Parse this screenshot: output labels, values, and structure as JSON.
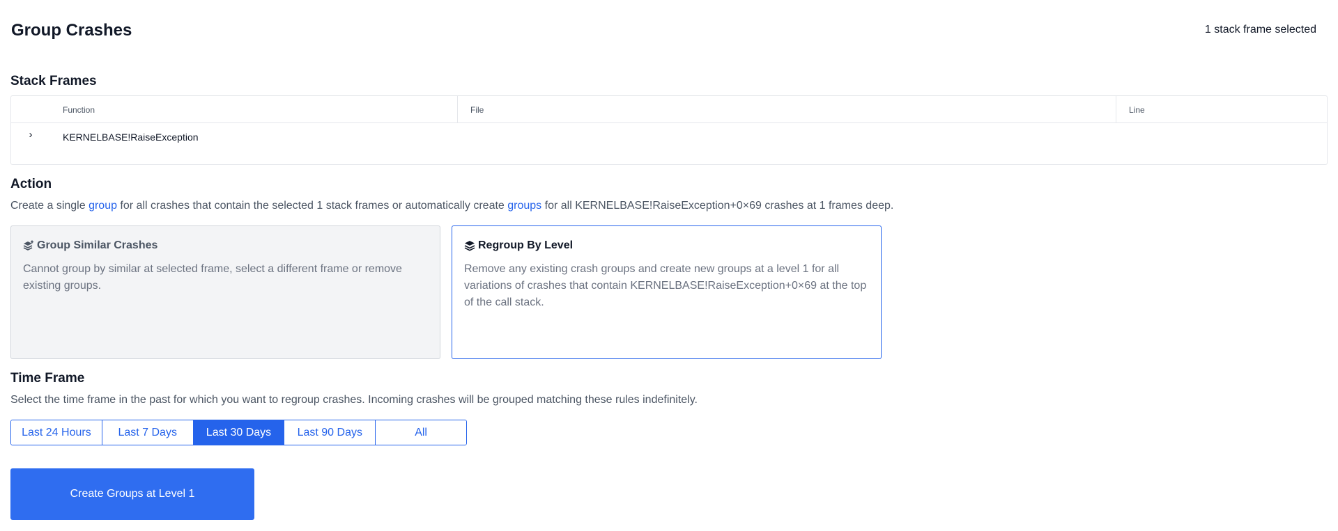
{
  "header": {
    "title": "Group Crashes",
    "selection_status": "1 stack frame selected"
  },
  "stack_frames": {
    "title": "Stack Frames",
    "columns": [
      "Function",
      "File",
      "Line"
    ],
    "rows": [
      {
        "function": "KERNELBASE!RaiseException",
        "file": "",
        "line": ""
      }
    ]
  },
  "action": {
    "title": "Action",
    "description_parts": [
      "Create a single ",
      "group",
      " for all crashes that contain the selected 1 stack frames or automatically create ",
      "groups",
      " for all KERNELBASE!RaiseException+0×69 crashes at 1 frames deep."
    ],
    "cards": [
      {
        "title": "Group Similar Crashes",
        "icon": "layers-plus-icon",
        "description": "Cannot group by similar at selected frame, select a different frame or remove existing groups.",
        "state": "disabled"
      },
      {
        "title": "Regroup By Level",
        "icon": "layers-icon",
        "description": "Remove any existing crash groups and create new groups at a level 1 for all variations of crashes that contain KERNELBASE!RaiseException+0×69 at the top of the call stack.",
        "state": "active"
      }
    ]
  },
  "time_frame": {
    "title": "Time Frame",
    "description": "Select the time frame in the past for which you want to regroup crashes. Incoming crashes will be grouped matching these rules indefinitely.",
    "options": [
      "Last 24 Hours",
      "Last 7 Days",
      "Last 30 Days",
      "Last 90 Days",
      "All"
    ],
    "selected": "Last 30 Days"
  },
  "submit": {
    "label": "Create Groups at Level 1"
  },
  "colors": {
    "accent": "#2563eb",
    "button": "#2f6df0",
    "muted_text": "#6b7280",
    "disabled_bg": "#f3f4f6"
  }
}
